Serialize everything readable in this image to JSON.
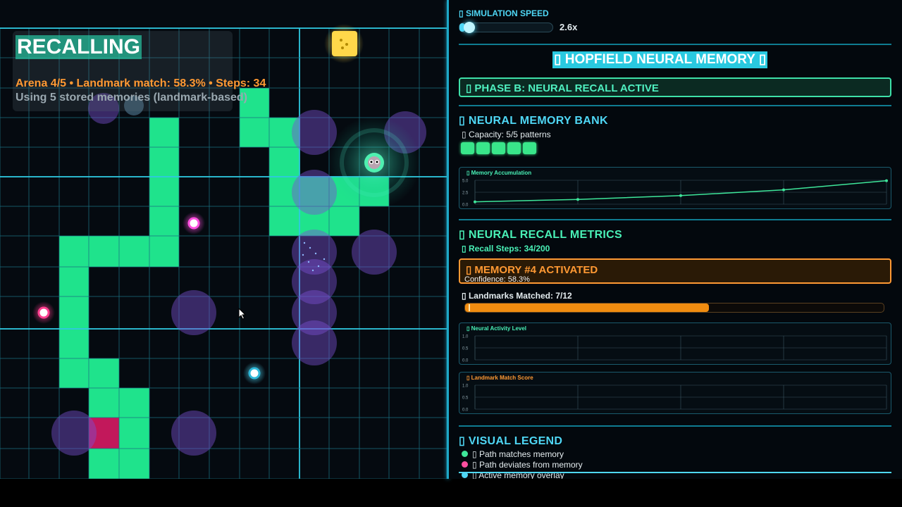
{
  "status": {
    "title": "RECALLING",
    "line1": "Arena 4/5 • Landmark match: 58.3% • Steps: 34",
    "line2": "Using 5 stored memories (landmark-based)"
  },
  "speed": {
    "label": "▯ SIMULATION SPEED",
    "value_text": "2.6x",
    "fraction": 0.05
  },
  "main_title": "▯ HOPFIELD NEURAL MEMORY ▯",
  "phase": "▯ PHASE B: NEURAL RECALL ACTIVE",
  "memory_bank": {
    "title": "▯ NEURAL MEMORY BANK",
    "capacity": "▯ Capacity: 5/5 patterns",
    "slots_filled": 5,
    "slots_total": 5
  },
  "charts": {
    "accumulation": {
      "title": "▯ Memory Accumulation",
      "y_ticks": [
        "5.0",
        "2.5",
        "0.0"
      ],
      "points": [
        0.5,
        1.0,
        1.8,
        3.0,
        4.9
      ],
      "ylim": [
        0,
        5
      ]
    },
    "activity": {
      "title": "▯ Neural Activity Level",
      "y_ticks": [
        "1.0",
        "0.5",
        "0.0"
      ]
    },
    "match": {
      "title": "▯ Landmark Match Score",
      "y_ticks": [
        "1.0",
        "0.5",
        "0.0"
      ]
    }
  },
  "recall": {
    "title": "▯ NEURAL RECALL METRICS",
    "steps": "▯ Recall Steps: 34/200",
    "activated_title": "▯ MEMORY #4 ACTIVATED",
    "confidence": "Confidence: 58.3%",
    "landmarks_label": "▯ Landmarks Matched: 7/12",
    "landmarks_fraction": 0.583
  },
  "legend": {
    "title": "▯ VISUAL LEGEND",
    "items": [
      {
        "label": "▯ Path matches memory",
        "color": "#3ee69a"
      },
      {
        "label": "▯ Path deviates from memory",
        "color": "#ff4fa0"
      },
      {
        "label": "▯ Active memory overlay",
        "color": "#4fd7f5"
      }
    ]
  },
  "colors": {
    "path": "#1fe38c",
    "deviation": "#c2185b",
    "memory_overlay": "#6a3fb0",
    "grid": "#1f8aa0",
    "accent": "#4fd7f5",
    "orange": "#ff9933"
  }
}
